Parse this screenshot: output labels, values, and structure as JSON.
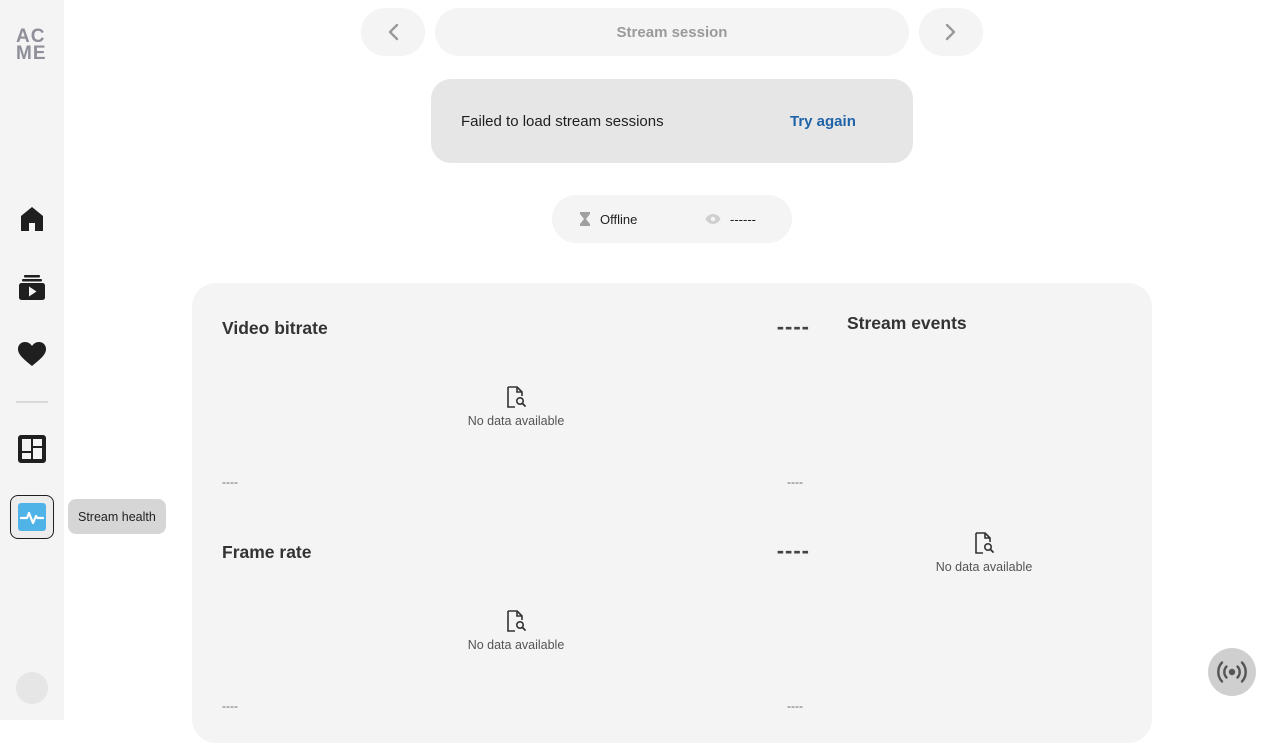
{
  "sidebar": {
    "logo_line1": "AC",
    "logo_line2": "ME",
    "items": [
      {
        "name": "home",
        "icon": "home-icon"
      },
      {
        "name": "videos",
        "icon": "video-library-icon"
      },
      {
        "name": "favorites",
        "icon": "heart-icon"
      },
      {
        "name": "dashboard",
        "icon": "dashboard-icon"
      },
      {
        "name": "stream-health",
        "icon": "pulse-icon",
        "active": true
      }
    ],
    "tooltip": "Stream health"
  },
  "session_nav": {
    "title": "Stream session"
  },
  "error": {
    "message": "Failed to load stream sessions",
    "action": "Try again"
  },
  "status": {
    "state": "Offline",
    "viewers": "------"
  },
  "metrics": {
    "video_bitrate": {
      "title": "Video bitrate",
      "value": "----",
      "axis_left": "----",
      "axis_right": "----",
      "empty": "No data available"
    },
    "frame_rate": {
      "title": "Frame rate",
      "value": "----",
      "axis_left": "----",
      "axis_right": "----",
      "empty": "No data available"
    },
    "stream_events": {
      "title": "Stream events",
      "empty": "No data available"
    }
  },
  "colors": {
    "accent": "#1f63a8",
    "active_icon": "#4fb3e8",
    "surface": "#f4f4f4"
  }
}
